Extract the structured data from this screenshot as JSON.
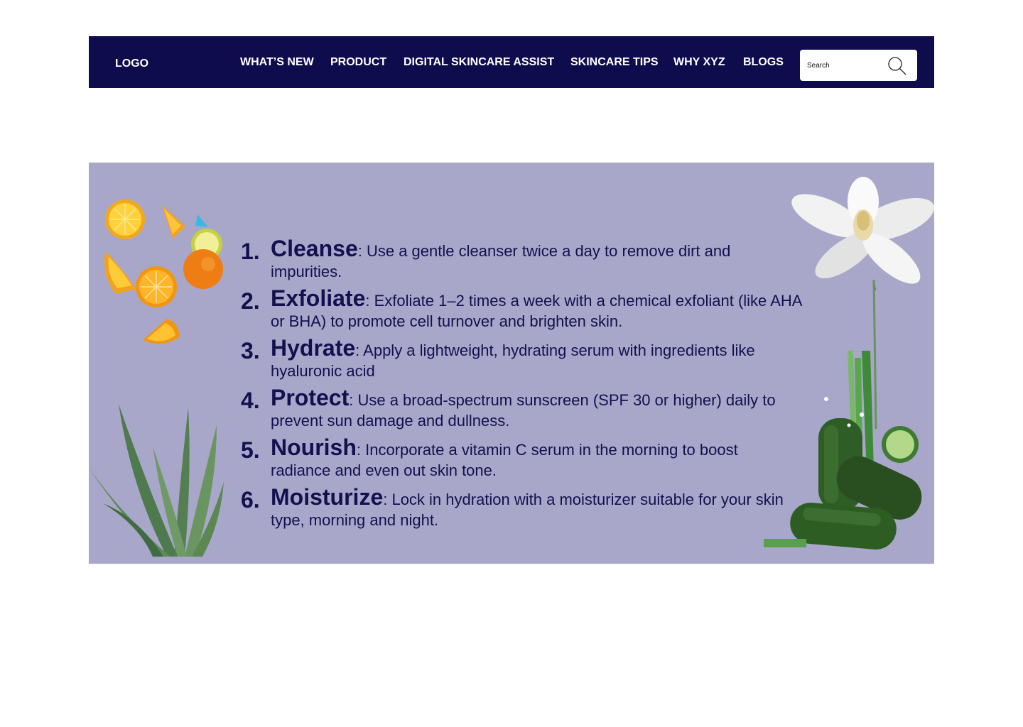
{
  "nav": {
    "logo": "LOGO",
    "items": [
      {
        "label": "WHAT’S NEW"
      },
      {
        "label": "PRODUCT"
      },
      {
        "label": "DIGITAL SKINCARE ASSIST"
      },
      {
        "label": "SKINCARE TIPS"
      },
      {
        "label": "WHY XYZ"
      },
      {
        "label": "BLOGS"
      }
    ],
    "search_placeholder": "Search"
  },
  "tips": [
    {
      "num": "1.",
      "title": "Cleanse",
      "text": ": Use a gentle cleanser twice a day to remove dirt and impurities."
    },
    {
      "num": "2.",
      "title": "Exfoliate",
      "text": ": Exfoliate 1–2 times a week with a chemical exfoliant (like AHA or BHA) to promote cell turnover and brighten skin."
    },
    {
      "num": "3.",
      "title": "Hydrate",
      "text": ": Apply a lightweight, hydrating serum with ingredients like hyaluronic acid"
    },
    {
      "num": "4.",
      "title": "Protect",
      "text": ": Use a broad-spectrum sunscreen (SPF 30 or higher) daily to prevent sun damage and dullness."
    },
    {
      "num": "5.",
      "title": "Nourish",
      "text": ": Incorporate a vitamin C serum in the morning to boost radiance and even out skin tone."
    },
    {
      "num": "6.",
      "title": "Moisturize",
      "text": ": Lock in hydration with a moisturizer suitable for your skin type, morning and night."
    }
  ],
  "colors": {
    "nav_bg": "#0f0c4d",
    "banner_bg": "#a8a7c9",
    "text": "#12104f"
  },
  "decorations": {
    "left_top": "citrus-slices-image",
    "left_bottom": "aloe-vera-image",
    "right_top": "magnolia-flower-image",
    "right_bottom": "cucumbers-image"
  }
}
